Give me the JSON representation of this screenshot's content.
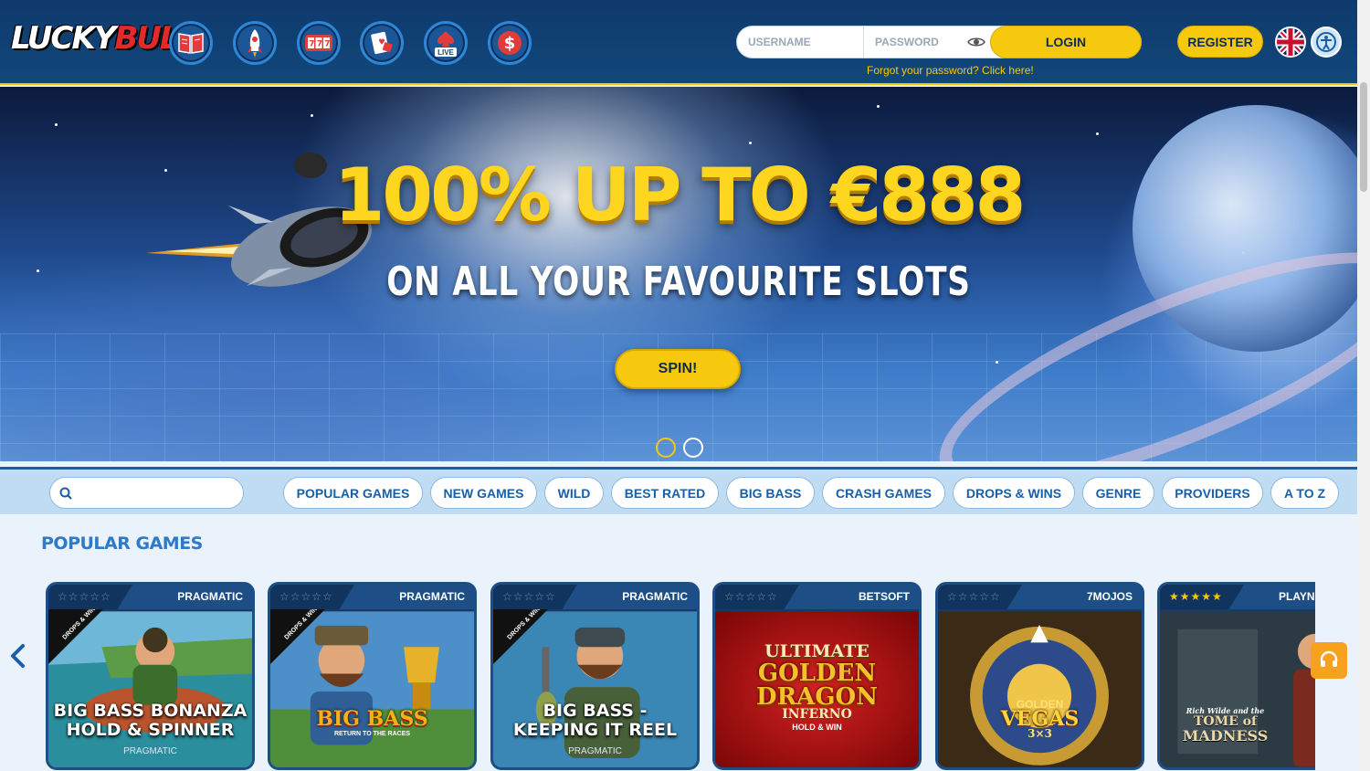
{
  "header": {
    "logo_part1": "LUCKY",
    "logo_part2": "BULL",
    "nav_icons": [
      "book-icon",
      "rocket-icon",
      "slot-machine-icon",
      "cards-icon",
      "live-casino-icon",
      "dollar-icon"
    ],
    "live_label": "LIVE",
    "username_placeholder": "USERNAME",
    "password_placeholder": "PASSWORD",
    "login_label": "LOGIN",
    "forgot_text": "Forgot your password? Click here!",
    "register_label": "REGISTER"
  },
  "banner": {
    "headline": "100% UP TO €888",
    "subline": "ON ALL YOUR FAVOURITE SLOTS",
    "cta_label": "SPIN!",
    "slides": 2,
    "active_slide": 1
  },
  "filters": {
    "search_placeholder": "",
    "chips": [
      "POPULAR GAMES",
      "NEW GAMES",
      "WILD",
      "BEST RATED",
      "BIG BASS",
      "CRASH GAMES",
      "DROPS & WINS",
      "GENRE",
      "PROVIDERS",
      "A TO Z"
    ]
  },
  "games": {
    "section_title": "POPULAR GAMES",
    "cards": [
      {
        "provider": "PRAGMATIC",
        "stars": "☆☆☆☆☆",
        "title_line1": "BIG BASS BONANZA",
        "title_line2": "HOLD & SPINNER",
        "sub": "PRAGMATIC",
        "badge": "DROPS & WINS"
      },
      {
        "provider": "PRAGMATIC",
        "stars": "☆☆☆☆☆",
        "logo": "BIG BASS",
        "logo_sub": "RETURN TO THE RACES",
        "badge": "DROPS & WINS"
      },
      {
        "provider": "PRAGMATIC",
        "stars": "☆☆☆☆☆",
        "title_line1": "BIG BASS -",
        "title_line2": "KEEPING IT REEL",
        "sub": "PRAGMATIC",
        "badge": "DROPS & WINS"
      },
      {
        "provider": "BETSOFT",
        "stars": "☆☆☆☆☆",
        "logo_l1": "ULTIMATE",
        "logo_l2": "GOLDEN",
        "logo_l3": "DRAGON",
        "logo_l4": "INFERNO",
        "logo_l5": "HOLD & WIN"
      },
      {
        "provider": "7MOJOS",
        "stars": "☆☆☆☆☆",
        "logo_l1": "GOLDEN",
        "logo_l2": "VEGAS",
        "logo_l3": "3×3"
      },
      {
        "provider": "PLAYNGO",
        "stars": "★★★★★",
        "rating": 4.5,
        "logo_pre": "Rich Wilde and the",
        "logo_l1": "TOME of",
        "logo_l2": "MADNESS"
      }
    ]
  },
  "colors": {
    "header_bg": "#124779",
    "accent_yellow": "#f6c90e",
    "chip_text": "#1a5fa6",
    "section_title": "#2f79c7"
  }
}
